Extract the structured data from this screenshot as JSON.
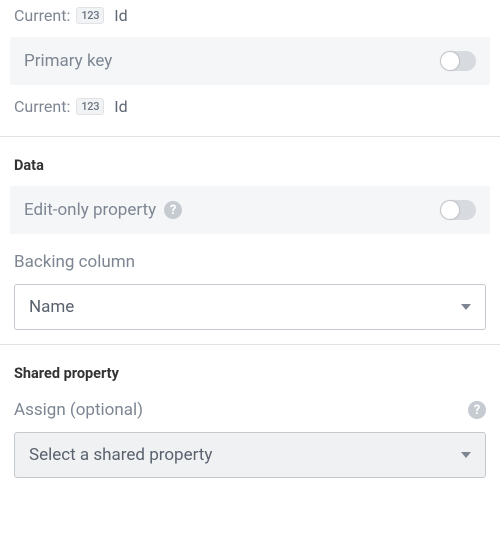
{
  "top": {
    "current1": {
      "label": "Current:",
      "type_badge": "123",
      "column_name": "Id"
    },
    "primary_key": {
      "label": "Primary key",
      "checked": false
    },
    "current2": {
      "label": "Current:",
      "type_badge": "123",
      "column_name": "Id"
    }
  },
  "data_section": {
    "heading": "Data",
    "edit_only": {
      "label": "Edit-only property",
      "help_glyph": "?",
      "checked": false
    },
    "backing_column": {
      "label": "Backing column",
      "value": "Name"
    }
  },
  "shared_section": {
    "heading": "Shared property",
    "assign": {
      "label": "Assign (optional)",
      "help_glyph": "?",
      "placeholder": "Select a shared property"
    }
  }
}
